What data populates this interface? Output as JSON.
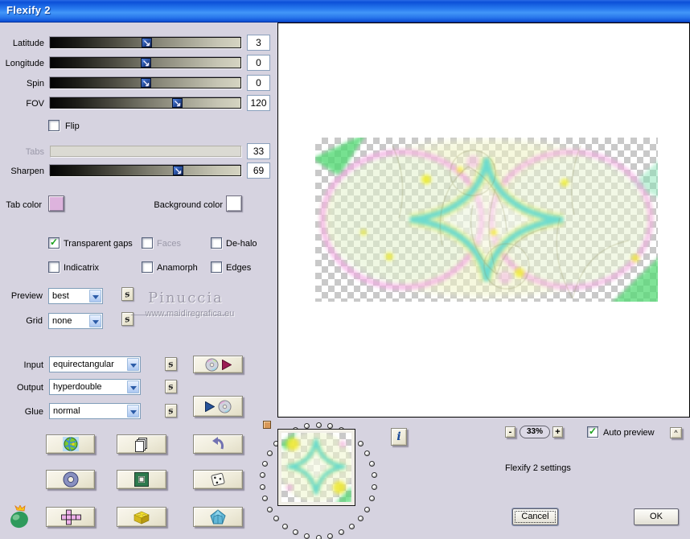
{
  "colors": {
    "dialog_bg": "#d6d3e0",
    "titlebar_blue": "#1c64e4",
    "combo_border": "#7f9db9",
    "check_green": "#1ba11b",
    "button_face": "#efecd9",
    "tab_color_swatch": "#ddb3dd",
    "background_color_swatch": "#ffffff",
    "memory_square": "#d89858"
  },
  "window": {
    "title": "Flexify 2"
  },
  "sliders": [
    {
      "label": "Latitude",
      "value": "3",
      "percent": 50.5,
      "disabled": false
    },
    {
      "label": "Longitude",
      "value": "0",
      "percent": 50,
      "disabled": false
    },
    {
      "label": "Spin",
      "value": "0",
      "percent": 50,
      "disabled": false
    },
    {
      "label": "FOV",
      "value": "120",
      "percent": 66.5,
      "disabled": false
    },
    {
      "label": "Tabs",
      "value": "33",
      "percent": null,
      "disabled": true
    },
    {
      "label": "Sharpen",
      "value": "69",
      "percent": 67,
      "disabled": false
    }
  ],
  "flip": {
    "label": "Flip",
    "checkmark": ""
  },
  "swatches": {
    "tab_color_label": "Tab color",
    "background_color_label": "Background color"
  },
  "options": {
    "transparent_gaps": {
      "label": "Transparent gaps",
      "checkmark": "✓"
    },
    "faces": {
      "label": "Faces",
      "checkmark": ""
    },
    "de_halo": {
      "label": "De-halo",
      "checkmark": ""
    },
    "indicatrix": {
      "label": "Indicatrix",
      "checkmark": ""
    },
    "anamorph": {
      "label": "Anamorph",
      "checkmark": ""
    },
    "edges": {
      "label": "Edges",
      "checkmark": ""
    }
  },
  "combos": {
    "preview": {
      "label": "Preview",
      "value": "best"
    },
    "grid": {
      "label": "Grid",
      "value": "none"
    },
    "input": {
      "label": "Input",
      "value": "equirectangular"
    },
    "output": {
      "label": "Output",
      "value": "hyperdouble"
    },
    "glue": {
      "label": "Glue",
      "value": "normal"
    }
  },
  "random": {
    "s_label": "s"
  },
  "watermark": {
    "name": "Pinuccia",
    "url": "www.maidiregrafica.eu"
  },
  "footer": {
    "info_label": "i",
    "zoom_out": "-",
    "zoom_level": "33%",
    "zoom_in": "+",
    "auto_preview": {
      "label": "Auto preview",
      "checkmark": "✓"
    },
    "collapse_label": "^",
    "settings_label": "Flexify 2 settings",
    "cancel_label": "Cancel",
    "ok_label": "OK"
  },
  "icons": {
    "grid_buttons": [
      "globe-icon",
      "copy-icon",
      "undo-icon",
      "torus-icon",
      "frame-icon",
      "dice-icon",
      "cube-net-icon",
      "brick-icon",
      "crystal-icon"
    ],
    "render_input_icons": [
      "cd-icon",
      "play-triangle-magenta-icon"
    ],
    "render_output_icons": [
      "play-triangle-blue-icon",
      "cd-icon"
    ],
    "logo": "flaming-pear-logo",
    "slider_thumb": "cursor-arrow-icon",
    "checkmark": "✓",
    "dropdown_arrow": "▼"
  }
}
